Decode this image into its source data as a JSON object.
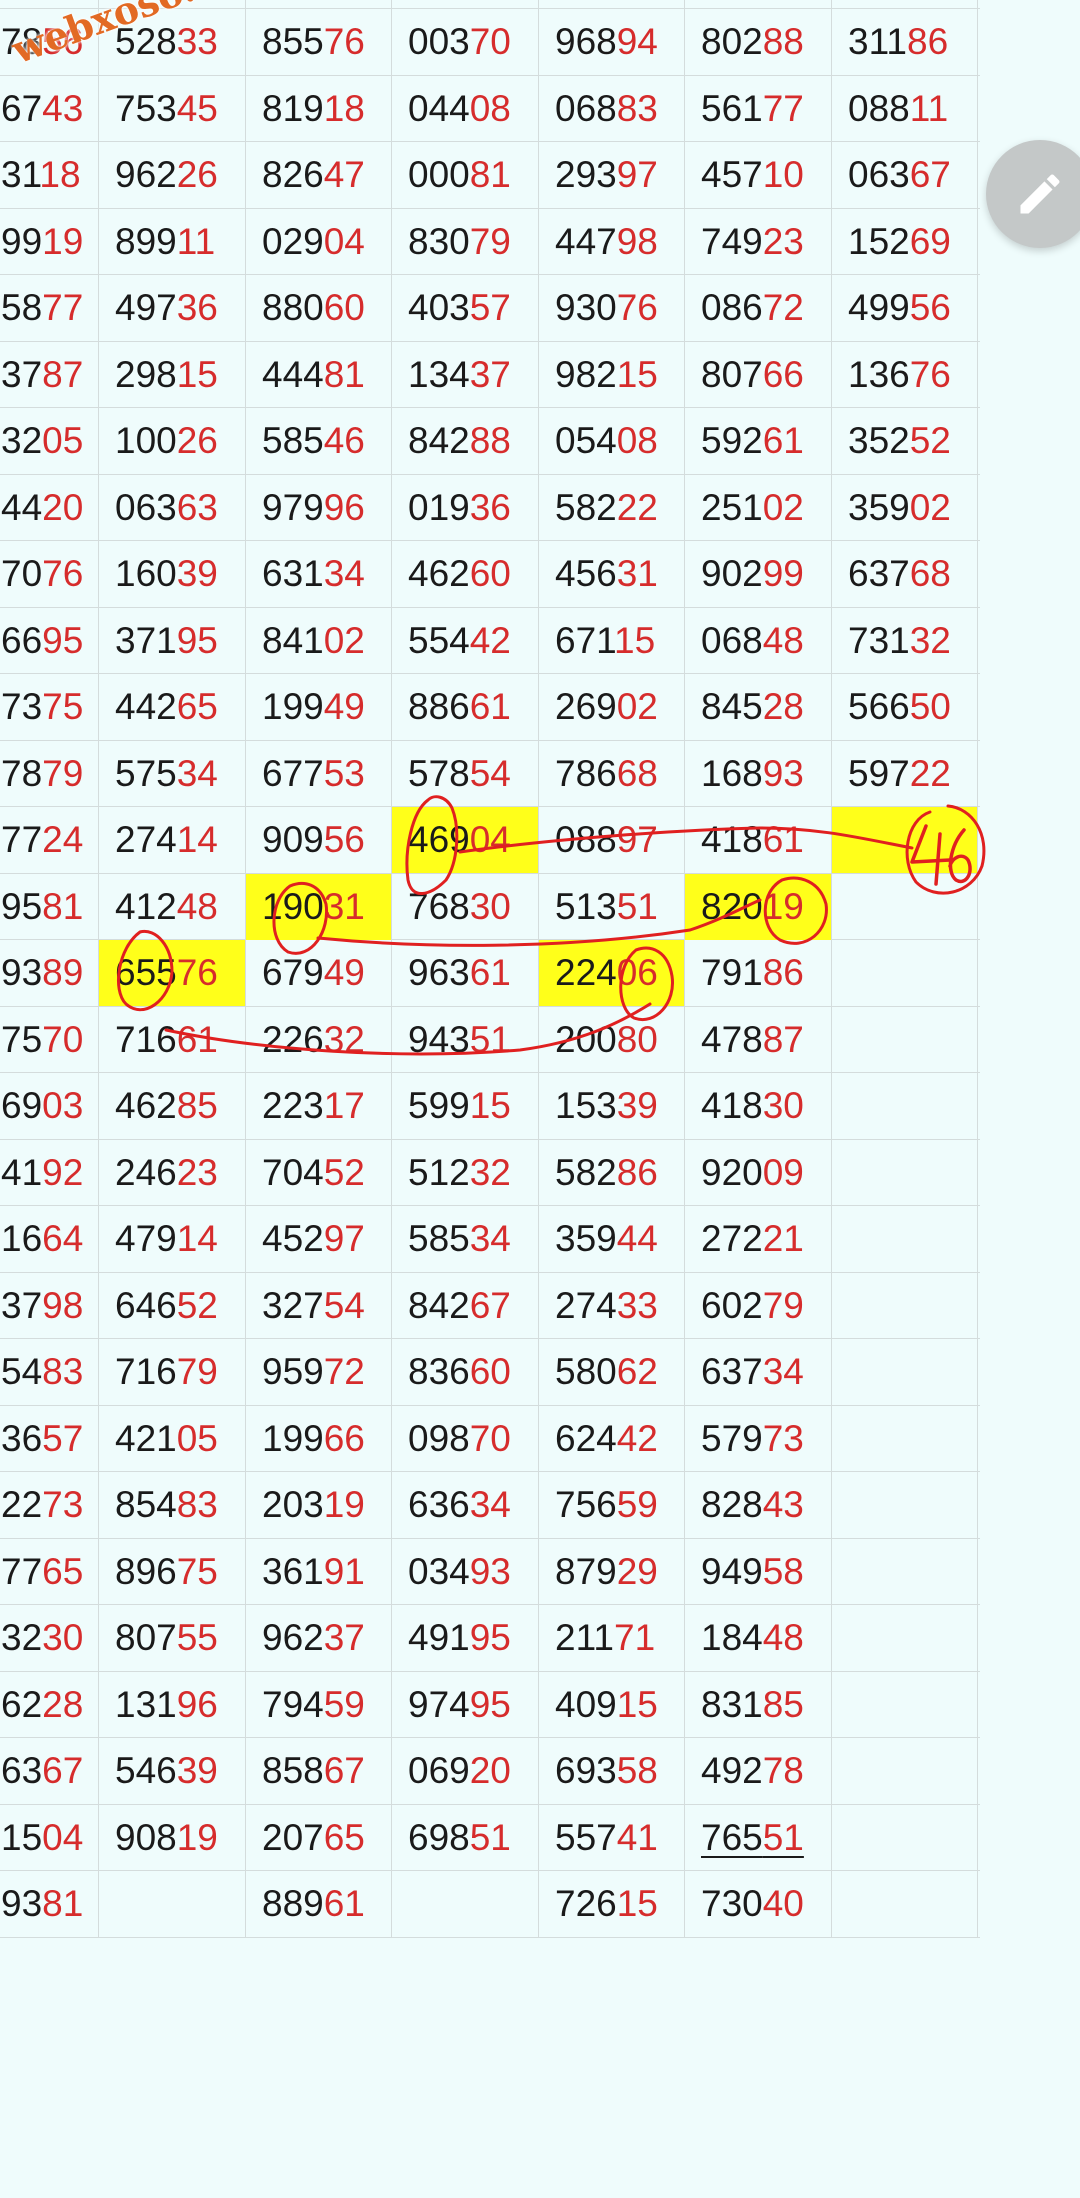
{
  "watermark": "webxoso.net",
  "colors": {
    "background": "#effcfc",
    "highlight": "#ffff1a",
    "red_digits": "#d62c2c",
    "ink": "#e02020"
  },
  "icons": {
    "fab": "pencil-icon"
  },
  "annotation": {
    "handwritten_number": "46"
  },
  "columns": [
    {
      "cells": [
        {
          "h": "78",
          "t": "56"
        },
        {
          "h": "67",
          "t": "43"
        },
        {
          "h": "31",
          "t": "18"
        },
        {
          "h": "99",
          "t": "19"
        },
        {
          "h": "58",
          "t": "77"
        },
        {
          "h": "37",
          "t": "87"
        },
        {
          "h": "32",
          "t": "05"
        },
        {
          "h": "44",
          "t": "20"
        },
        {
          "h": "70",
          "t": "76"
        },
        {
          "h": "66",
          "t": "95"
        },
        {
          "h": "73",
          "t": "75"
        },
        {
          "h": "78",
          "t": "79"
        },
        {
          "h": "77",
          "t": "24"
        },
        {
          "h": "95",
          "t": "81"
        },
        {
          "h": "93",
          "t": "89"
        },
        {
          "h": "75",
          "t": "70"
        },
        {
          "h": "69",
          "t": "03"
        },
        {
          "h": "41",
          "t": "92"
        },
        {
          "h": "16",
          "t": "64"
        },
        {
          "h": "37",
          "t": "98"
        },
        {
          "h": "54",
          "t": "83"
        },
        {
          "h": "36",
          "t": "57"
        },
        {
          "h": "22",
          "t": "73"
        },
        {
          "h": "77",
          "t": "65"
        },
        {
          "h": "32",
          "t": "30"
        },
        {
          "h": "62",
          "t": "28"
        },
        {
          "h": "63",
          "t": "67"
        },
        {
          "h": "15",
          "t": "04"
        },
        {
          "h": "93",
          "t": "81"
        }
      ]
    },
    {
      "cells": [
        {
          "h": "528",
          "t": "33"
        },
        {
          "h": "753",
          "t": "45"
        },
        {
          "h": "962",
          "t": "26"
        },
        {
          "h": "899",
          "t": "11"
        },
        {
          "h": "497",
          "t": "36"
        },
        {
          "h": "298",
          "t": "15"
        },
        {
          "h": "100",
          "t": "26"
        },
        {
          "h": "063",
          "t": "63"
        },
        {
          "h": "160",
          "t": "39"
        },
        {
          "h": "371",
          "t": "95"
        },
        {
          "h": "442",
          "t": "65"
        },
        {
          "h": "575",
          "t": "34"
        },
        {
          "h": "274",
          "t": "14"
        },
        {
          "h": "412",
          "t": "48"
        },
        {
          "h": "655",
          "t": "76",
          "hl": true
        },
        {
          "h": "716",
          "t": "61"
        },
        {
          "h": "462",
          "t": "85"
        },
        {
          "h": "246",
          "t": "23"
        },
        {
          "h": "479",
          "t": "14"
        },
        {
          "h": "646",
          "t": "52"
        },
        {
          "h": "716",
          "t": "79"
        },
        {
          "h": "421",
          "t": "05"
        },
        {
          "h": "854",
          "t": "83"
        },
        {
          "h": "896",
          "t": "75"
        },
        {
          "h": "807",
          "t": "55"
        },
        {
          "h": "131",
          "t": "96"
        },
        {
          "h": "546",
          "t": "39"
        },
        {
          "h": "908",
          "t": "19"
        },
        {
          "h": "",
          "t": ""
        }
      ]
    },
    {
      "cells": [
        {
          "h": "855",
          "t": "76"
        },
        {
          "h": "819",
          "t": "18"
        },
        {
          "h": "826",
          "t": "47"
        },
        {
          "h": "029",
          "t": "04"
        },
        {
          "h": "880",
          "t": "60"
        },
        {
          "h": "444",
          "t": "81"
        },
        {
          "h": "585",
          "t": "46"
        },
        {
          "h": "979",
          "t": "96"
        },
        {
          "h": "631",
          "t": "34"
        },
        {
          "h": "841",
          "t": "02"
        },
        {
          "h": "199",
          "t": "49"
        },
        {
          "h": "677",
          "t": "53"
        },
        {
          "h": "909",
          "t": "56"
        },
        {
          "h": "190",
          "t": "31",
          "hl": true
        },
        {
          "h": "679",
          "t": "49"
        },
        {
          "h": "226",
          "t": "32"
        },
        {
          "h": "223",
          "t": "17"
        },
        {
          "h": "704",
          "t": "52"
        },
        {
          "h": "452",
          "t": "97"
        },
        {
          "h": "327",
          "t": "54"
        },
        {
          "h": "959",
          "t": "72"
        },
        {
          "h": "199",
          "t": "66"
        },
        {
          "h": "203",
          "t": "19"
        },
        {
          "h": "361",
          "t": "91"
        },
        {
          "h": "962",
          "t": "37"
        },
        {
          "h": "794",
          "t": "59"
        },
        {
          "h": "858",
          "t": "67"
        },
        {
          "h": "207",
          "t": "65"
        },
        {
          "h": "889",
          "t": "61"
        }
      ]
    },
    {
      "cells": [
        {
          "h": "003",
          "t": "70"
        },
        {
          "h": "044",
          "t": "08"
        },
        {
          "h": "000",
          "t": "81"
        },
        {
          "h": "830",
          "t": "79"
        },
        {
          "h": "403",
          "t": "57"
        },
        {
          "h": "134",
          "t": "37"
        },
        {
          "h": "842",
          "t": "88"
        },
        {
          "h": "019",
          "t": "36"
        },
        {
          "h": "462",
          "t": "60"
        },
        {
          "h": "554",
          "t": "42"
        },
        {
          "h": "886",
          "t": "61"
        },
        {
          "h": "578",
          "t": "54"
        },
        {
          "h": "469",
          "t": "04",
          "hl": true
        },
        {
          "h": "768",
          "t": "30"
        },
        {
          "h": "963",
          "t": "61"
        },
        {
          "h": "943",
          "t": "51"
        },
        {
          "h": "599",
          "t": "15"
        },
        {
          "h": "512",
          "t": "32"
        },
        {
          "h": "585",
          "t": "34"
        },
        {
          "h": "842",
          "t": "67"
        },
        {
          "h": "836",
          "t": "60"
        },
        {
          "h": "098",
          "t": "70"
        },
        {
          "h": "636",
          "t": "34"
        },
        {
          "h": "034",
          "t": "93"
        },
        {
          "h": "491",
          "t": "95"
        },
        {
          "h": "974",
          "t": "95"
        },
        {
          "h": "069",
          "t": "20"
        },
        {
          "h": "698",
          "t": "51"
        },
        {
          "h": "",
          "t": ""
        }
      ]
    },
    {
      "cells": [
        {
          "h": "968",
          "t": "94"
        },
        {
          "h": "068",
          "t": "83"
        },
        {
          "h": "293",
          "t": "97"
        },
        {
          "h": "447",
          "t": "98"
        },
        {
          "h": "930",
          "t": "76"
        },
        {
          "h": "982",
          "t": "15"
        },
        {
          "h": "054",
          "t": "08"
        },
        {
          "h": "582",
          "t": "22"
        },
        {
          "h": "456",
          "t": "31"
        },
        {
          "h": "671",
          "t": "15"
        },
        {
          "h": "269",
          "t": "02"
        },
        {
          "h": "786",
          "t": "68"
        },
        {
          "h": "088",
          "t": "97"
        },
        {
          "h": "513",
          "t": "51"
        },
        {
          "h": "224",
          "t": "06",
          "hl": true
        },
        {
          "h": "200",
          "t": "80"
        },
        {
          "h": "153",
          "t": "39"
        },
        {
          "h": "582",
          "t": "86"
        },
        {
          "h": "359",
          "t": "44"
        },
        {
          "h": "274",
          "t": "33"
        },
        {
          "h": "580",
          "t": "62"
        },
        {
          "h": "624",
          "t": "42"
        },
        {
          "h": "756",
          "t": "59"
        },
        {
          "h": "879",
          "t": "29"
        },
        {
          "h": "211",
          "t": "71"
        },
        {
          "h": "409",
          "t": "15"
        },
        {
          "h": "693",
          "t": "58"
        },
        {
          "h": "557",
          "t": "41"
        },
        {
          "h": "726",
          "t": "15"
        }
      ]
    },
    {
      "cells": [
        {
          "h": "802",
          "t": "88"
        },
        {
          "h": "561",
          "t": "77"
        },
        {
          "h": "457",
          "t": "10"
        },
        {
          "h": "749",
          "t": "23"
        },
        {
          "h": "086",
          "t": "72"
        },
        {
          "h": "807",
          "t": "66"
        },
        {
          "h": "592",
          "t": "61"
        },
        {
          "h": "251",
          "t": "02"
        },
        {
          "h": "902",
          "t": "99"
        },
        {
          "h": "068",
          "t": "48"
        },
        {
          "h": "845",
          "t": "28"
        },
        {
          "h": "168",
          "t": "93"
        },
        {
          "h": "418",
          "t": "61"
        },
        {
          "h": "820",
          "t": "19",
          "hl": true
        },
        {
          "h": "791",
          "t": "86"
        },
        {
          "h": "478",
          "t": "87"
        },
        {
          "h": "418",
          "t": "30"
        },
        {
          "h": "920",
          "t": "09"
        },
        {
          "h": "272",
          "t": "21"
        },
        {
          "h": "602",
          "t": "79"
        },
        {
          "h": "637",
          "t": "34"
        },
        {
          "h": "579",
          "t": "73"
        },
        {
          "h": "828",
          "t": "43"
        },
        {
          "h": "949",
          "t": "58"
        },
        {
          "h": "184",
          "t": "48"
        },
        {
          "h": "831",
          "t": "85"
        },
        {
          "h": "492",
          "t": "78"
        },
        {
          "h": "765",
          "t": "51",
          "ul": true
        },
        {
          "h": "730",
          "t": "40"
        }
      ]
    },
    {
      "cells": [
        {
          "h": "311",
          "t": "86"
        },
        {
          "h": "088",
          "t": "11"
        },
        {
          "h": "063",
          "t": "67"
        },
        {
          "h": "152",
          "t": "69"
        },
        {
          "h": "499",
          "t": "56"
        },
        {
          "h": "136",
          "t": "76"
        },
        {
          "h": "352",
          "t": "52"
        },
        {
          "h": "359",
          "t": "02"
        },
        {
          "h": "637",
          "t": "68"
        },
        {
          "h": "731",
          "t": "32"
        },
        {
          "h": "566",
          "t": "50"
        },
        {
          "h": "597",
          "t": "22"
        },
        {
          "h": "",
          "t": "",
          "hl": true
        }
      ]
    }
  ]
}
